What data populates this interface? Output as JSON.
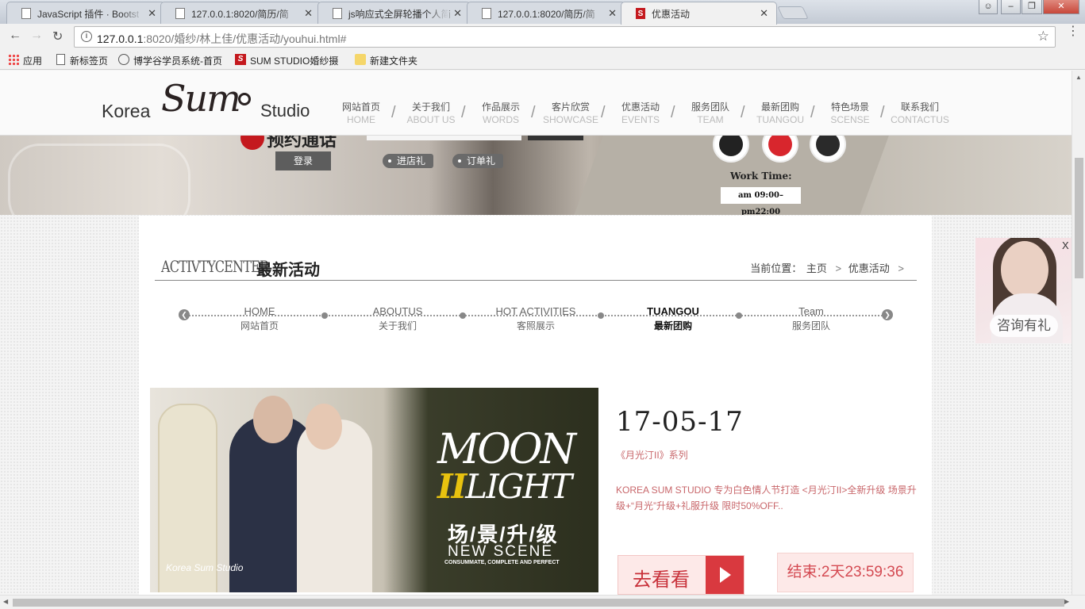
{
  "browser": {
    "tabs": [
      {
        "title": "JavaScript 插件 · Bootst",
        "icon": "page-icon"
      },
      {
        "title": "127.0.0.1:8020/简历/简",
        "icon": "page-icon"
      },
      {
        "title": "js响应式全屏轮播个人简",
        "icon": "page-icon"
      },
      {
        "title": "127.0.0.1:8020/简历/简",
        "icon": "page-icon"
      },
      {
        "title": "优惠活动",
        "icon": "s-icon",
        "icon_letter": "S",
        "active": true
      }
    ],
    "close_glyph": "✕",
    "url_host": "127.0.0.1",
    "url_rest": ":8020/婚纱/林上佳/优惠活动/youhui.html#",
    "bookmarks": [
      {
        "label": "应用",
        "icon": "apps-icon"
      },
      {
        "label": "新标签页",
        "icon": "page-icon"
      },
      {
        "label": "博学谷学员系统-首页",
        "icon": "globe-icon"
      },
      {
        "label": "SUM STUDIO婚纱摄",
        "icon": "s-icon",
        "icon_letter": "S"
      },
      {
        "label": "新建文件夹",
        "icon": "folder-icon"
      }
    ]
  },
  "site": {
    "logo": {
      "korea": "Korea",
      "sum": "Sum",
      "studio": "Studio"
    },
    "nav": [
      {
        "cn": "网站首页",
        "en": "HOME"
      },
      {
        "cn": "关于我们",
        "en": "ABOUT US"
      },
      {
        "cn": "作品展示",
        "en": "WORDS"
      },
      {
        "cn": "客片欣赏",
        "en": "SHOWCASE"
      },
      {
        "cn": "优惠活动",
        "en": "EVENTS"
      },
      {
        "cn": "服务团队",
        "en": "TEAM"
      },
      {
        "cn": "最新团购",
        "en": "TUANGOU"
      },
      {
        "cn": "特色场景",
        "en": "SCENSE"
      },
      {
        "cn": "联系我们",
        "en": "CONTACTUS"
      }
    ],
    "nav_separator": "/",
    "banner": {
      "brand_text": "预约通话",
      "login": "登录",
      "tags": [
        "进店礼",
        "订单礼"
      ],
      "social_icons": [
        "qq-icon",
        "weibo-icon",
        "wechat-icon"
      ],
      "work_time_label": "Work Time:",
      "work_hours": "am 09:00–pm22:00"
    },
    "section": {
      "title_en": "ACTIVTYCENTER",
      "title_cn": "最新活动",
      "breadcrumb": {
        "label": "当前位置：",
        "items": [
          "主页",
          "优惠活动"
        ],
        "separator": ">"
      }
    },
    "subnav": [
      {
        "en": "HOME",
        "cn": "网站首页",
        "active": false
      },
      {
        "en": "ABOUTUS",
        "cn": "关于我们",
        "active": false
      },
      {
        "en": "HOT ACTIVITIES",
        "cn": "客照展示",
        "active": false
      },
      {
        "en": "TUANGOU",
        "cn": "最新团购",
        "active": true
      },
      {
        "en": "Team",
        "cn": "服务团队",
        "active": false
      }
    ],
    "promo": {
      "image": {
        "moon": "MOON",
        "light_prefix": "II",
        "light": "LIGHT",
        "cn": "场/景/升/级",
        "new_scene": "NEW SCENE",
        "sub": "CONSUMMATE, COMPLETE AND PERFECT",
        "watermark": "Korea Sum Studio"
      },
      "date": "17-05-17",
      "series": "《月光汀II》系列",
      "description": "KOREA SUM STUDIO 专为白色情人节打造 <月光汀II>全新升级 场景升级+“月光”升级+礼服升级 限时50%OFF..",
      "go_label": "去看看",
      "countdown": "结束:2天23:59:36"
    },
    "consult": {
      "label": "咨询有礼",
      "close": "X"
    }
  }
}
